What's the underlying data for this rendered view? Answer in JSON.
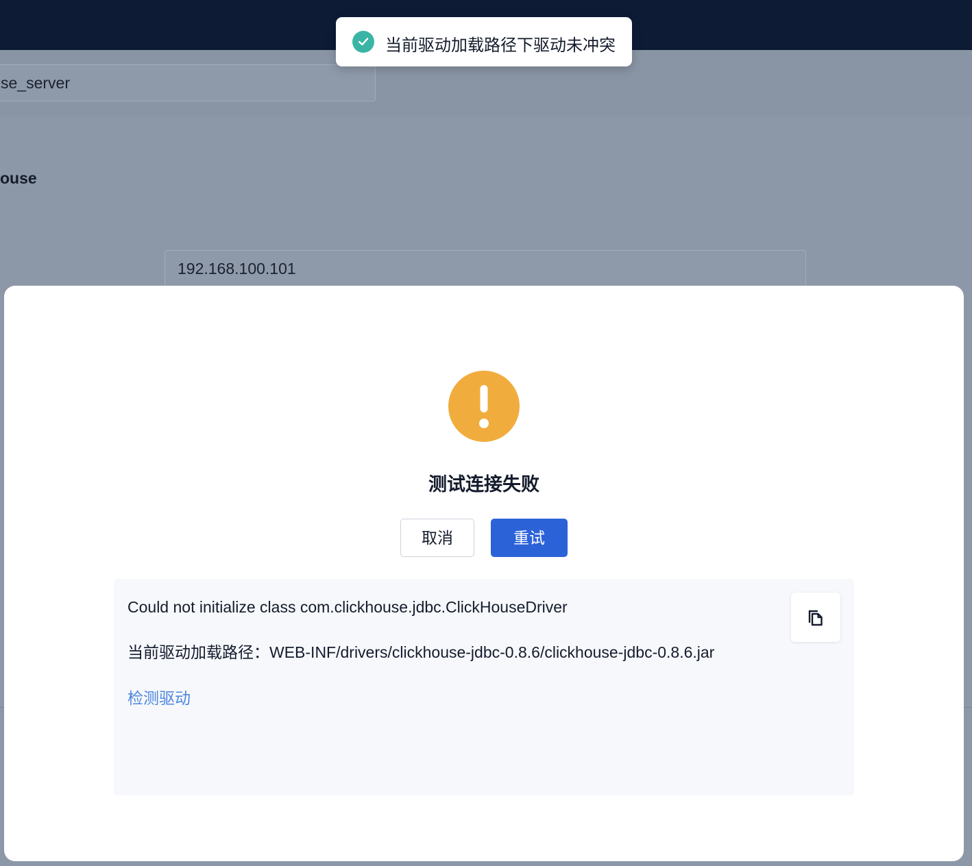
{
  "background": {
    "name_input_value": "se_server",
    "type_label": "ouse",
    "host_input_value": "192.168.100.101"
  },
  "toast": {
    "icon": "check-circle-icon",
    "message": "当前驱动加载路径下驱动未冲突",
    "color": "#3ab5a5"
  },
  "dialog": {
    "icon": "warning-icon",
    "icon_color": "#f0ad3e",
    "title": "测试连接失败",
    "cancel_label": "取消",
    "retry_label": "重试",
    "retry_color": "#2c62d8",
    "error": {
      "message": "Could not initialize class com.clickhouse.jdbc.ClickHouseDriver",
      "driver_path": "当前驱动加载路径：WEB-INF/drivers/clickhouse-jdbc-0.8.6/clickhouse-jdbc-0.8.6.jar",
      "detect_link": "检测驱动",
      "copy_icon": "copy-icon"
    }
  }
}
